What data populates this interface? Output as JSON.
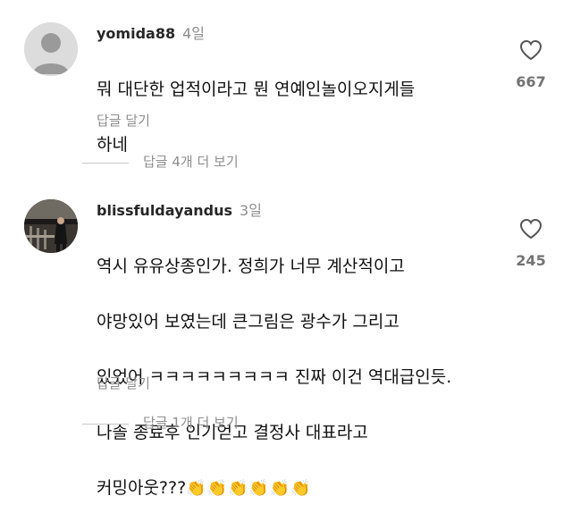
{
  "comments": [
    {
      "username": "yomida88",
      "time": "4일",
      "text_lines": [
        "뭐 대단한 업적이라고 뭔 연예인놀이오지게들",
        "하네"
      ],
      "reply_label": "답글 달기",
      "likes": "667",
      "avatar": "default-avatar"
    },
    {
      "username": "blissfuldayandus",
      "time": "3일",
      "text_lines": [
        "역시 유유상종인가. 정희가 너무 계산적이고",
        "야망있어 보였는데 큰그림은 광수가 그리고",
        "있었어 ㅋㅋㅋㅋㅋㅋㅋㅋㅋ 진짜 이건 역대급인듯.",
        "나솔 종료후 인기얻고 결정사 대표라고"
      ],
      "last_line_text": "커밍아웃???",
      "emoji": "👏👏👏👏👏👏",
      "reply_label": "답글 달기",
      "likes": "245",
      "avatar": "photo-avatar"
    }
  ],
  "more_replies": [
    {
      "label": "답글 4개 더 보기"
    },
    {
      "label": "답글 1개 더 보기"
    }
  ],
  "colors": {
    "text": "#111111",
    "muted": "#8e8e8e",
    "like_count": "#737373",
    "divider": "#c7c7c7"
  }
}
